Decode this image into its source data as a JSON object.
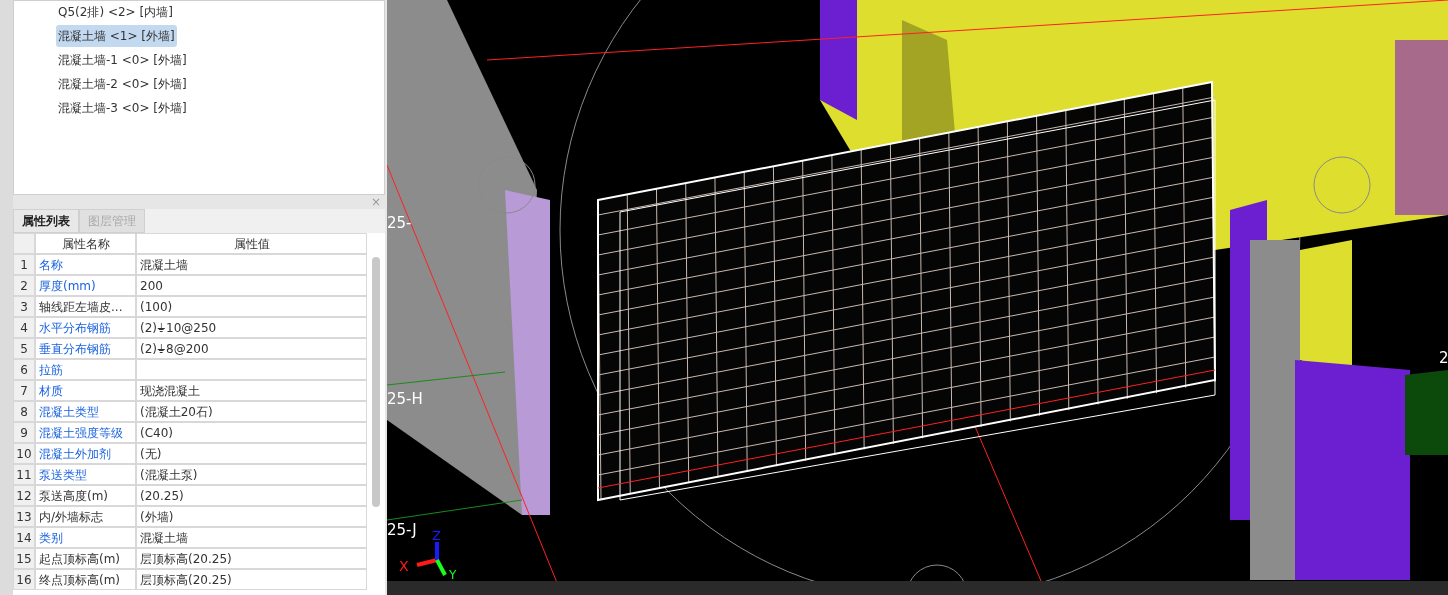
{
  "tree": {
    "items": [
      {
        "label": "Q5(2排) <2> [内墙]",
        "selected": false
      },
      {
        "label": "混凝土墙 <1> [外墙]",
        "selected": true
      },
      {
        "label": "混凝土墙-1 <0> [外墙]",
        "selected": false
      },
      {
        "label": "混凝土墙-2 <0> [外墙]",
        "selected": false
      },
      {
        "label": "混凝土墙-3 <0> [外墙]",
        "selected": false
      }
    ]
  },
  "panel": {
    "close": "×",
    "tabs": [
      {
        "label": "属性列表",
        "selected": true
      },
      {
        "label": "图层管理",
        "selected": false
      }
    ],
    "columns": [
      "属性名称",
      "属性值"
    ],
    "rows": [
      {
        "index": "1",
        "name": "名称",
        "value": "混凝土墙",
        "linked": true
      },
      {
        "index": "2",
        "name": "厚度(mm)",
        "value": "200",
        "linked": true
      },
      {
        "index": "3",
        "name": "轴线距左墙皮...",
        "value": "(100)",
        "linked": false
      },
      {
        "index": "4",
        "name": "水平分布钢筋",
        "value": "(2)⏚10@250",
        "linked": true
      },
      {
        "index": "5",
        "name": "垂直分布钢筋",
        "value": "(2)⏚8@200",
        "linked": true
      },
      {
        "index": "6",
        "name": "拉筋",
        "value": "",
        "linked": true
      },
      {
        "index": "7",
        "name": "材质",
        "value": "现浇混凝土",
        "linked": true
      },
      {
        "index": "8",
        "name": "混凝土类型",
        "value": "(混凝土20石)",
        "linked": true
      },
      {
        "index": "9",
        "name": "混凝土强度等级",
        "value": "(C40)",
        "linked": true
      },
      {
        "index": "10",
        "name": "混凝土外加剂",
        "value": "(无)",
        "linked": true
      },
      {
        "index": "11",
        "name": "泵送类型",
        "value": "(混凝土泵)",
        "linked": true
      },
      {
        "index": "12",
        "name": "泵送高度(m)",
        "value": "(20.25)",
        "linked": false
      },
      {
        "index": "13",
        "name": "内/外墙标志",
        "value": "(外墙)",
        "linked": false
      },
      {
        "index": "14",
        "name": "类别",
        "value": "混凝土墙",
        "linked": true
      },
      {
        "index": "15",
        "name": "起点顶标高(m)",
        "value": "层顶标高(20.25)",
        "linked": false
      },
      {
        "index": "16",
        "name": "终点顶标高(m)",
        "value": "层顶标高(20.25)",
        "linked": false
      }
    ]
  },
  "viewport": {
    "axis_labels": [
      "25-",
      "25-H",
      "25-J",
      "2"
    ],
    "gizmo_axes": [
      "X",
      "Y",
      "Z"
    ]
  }
}
